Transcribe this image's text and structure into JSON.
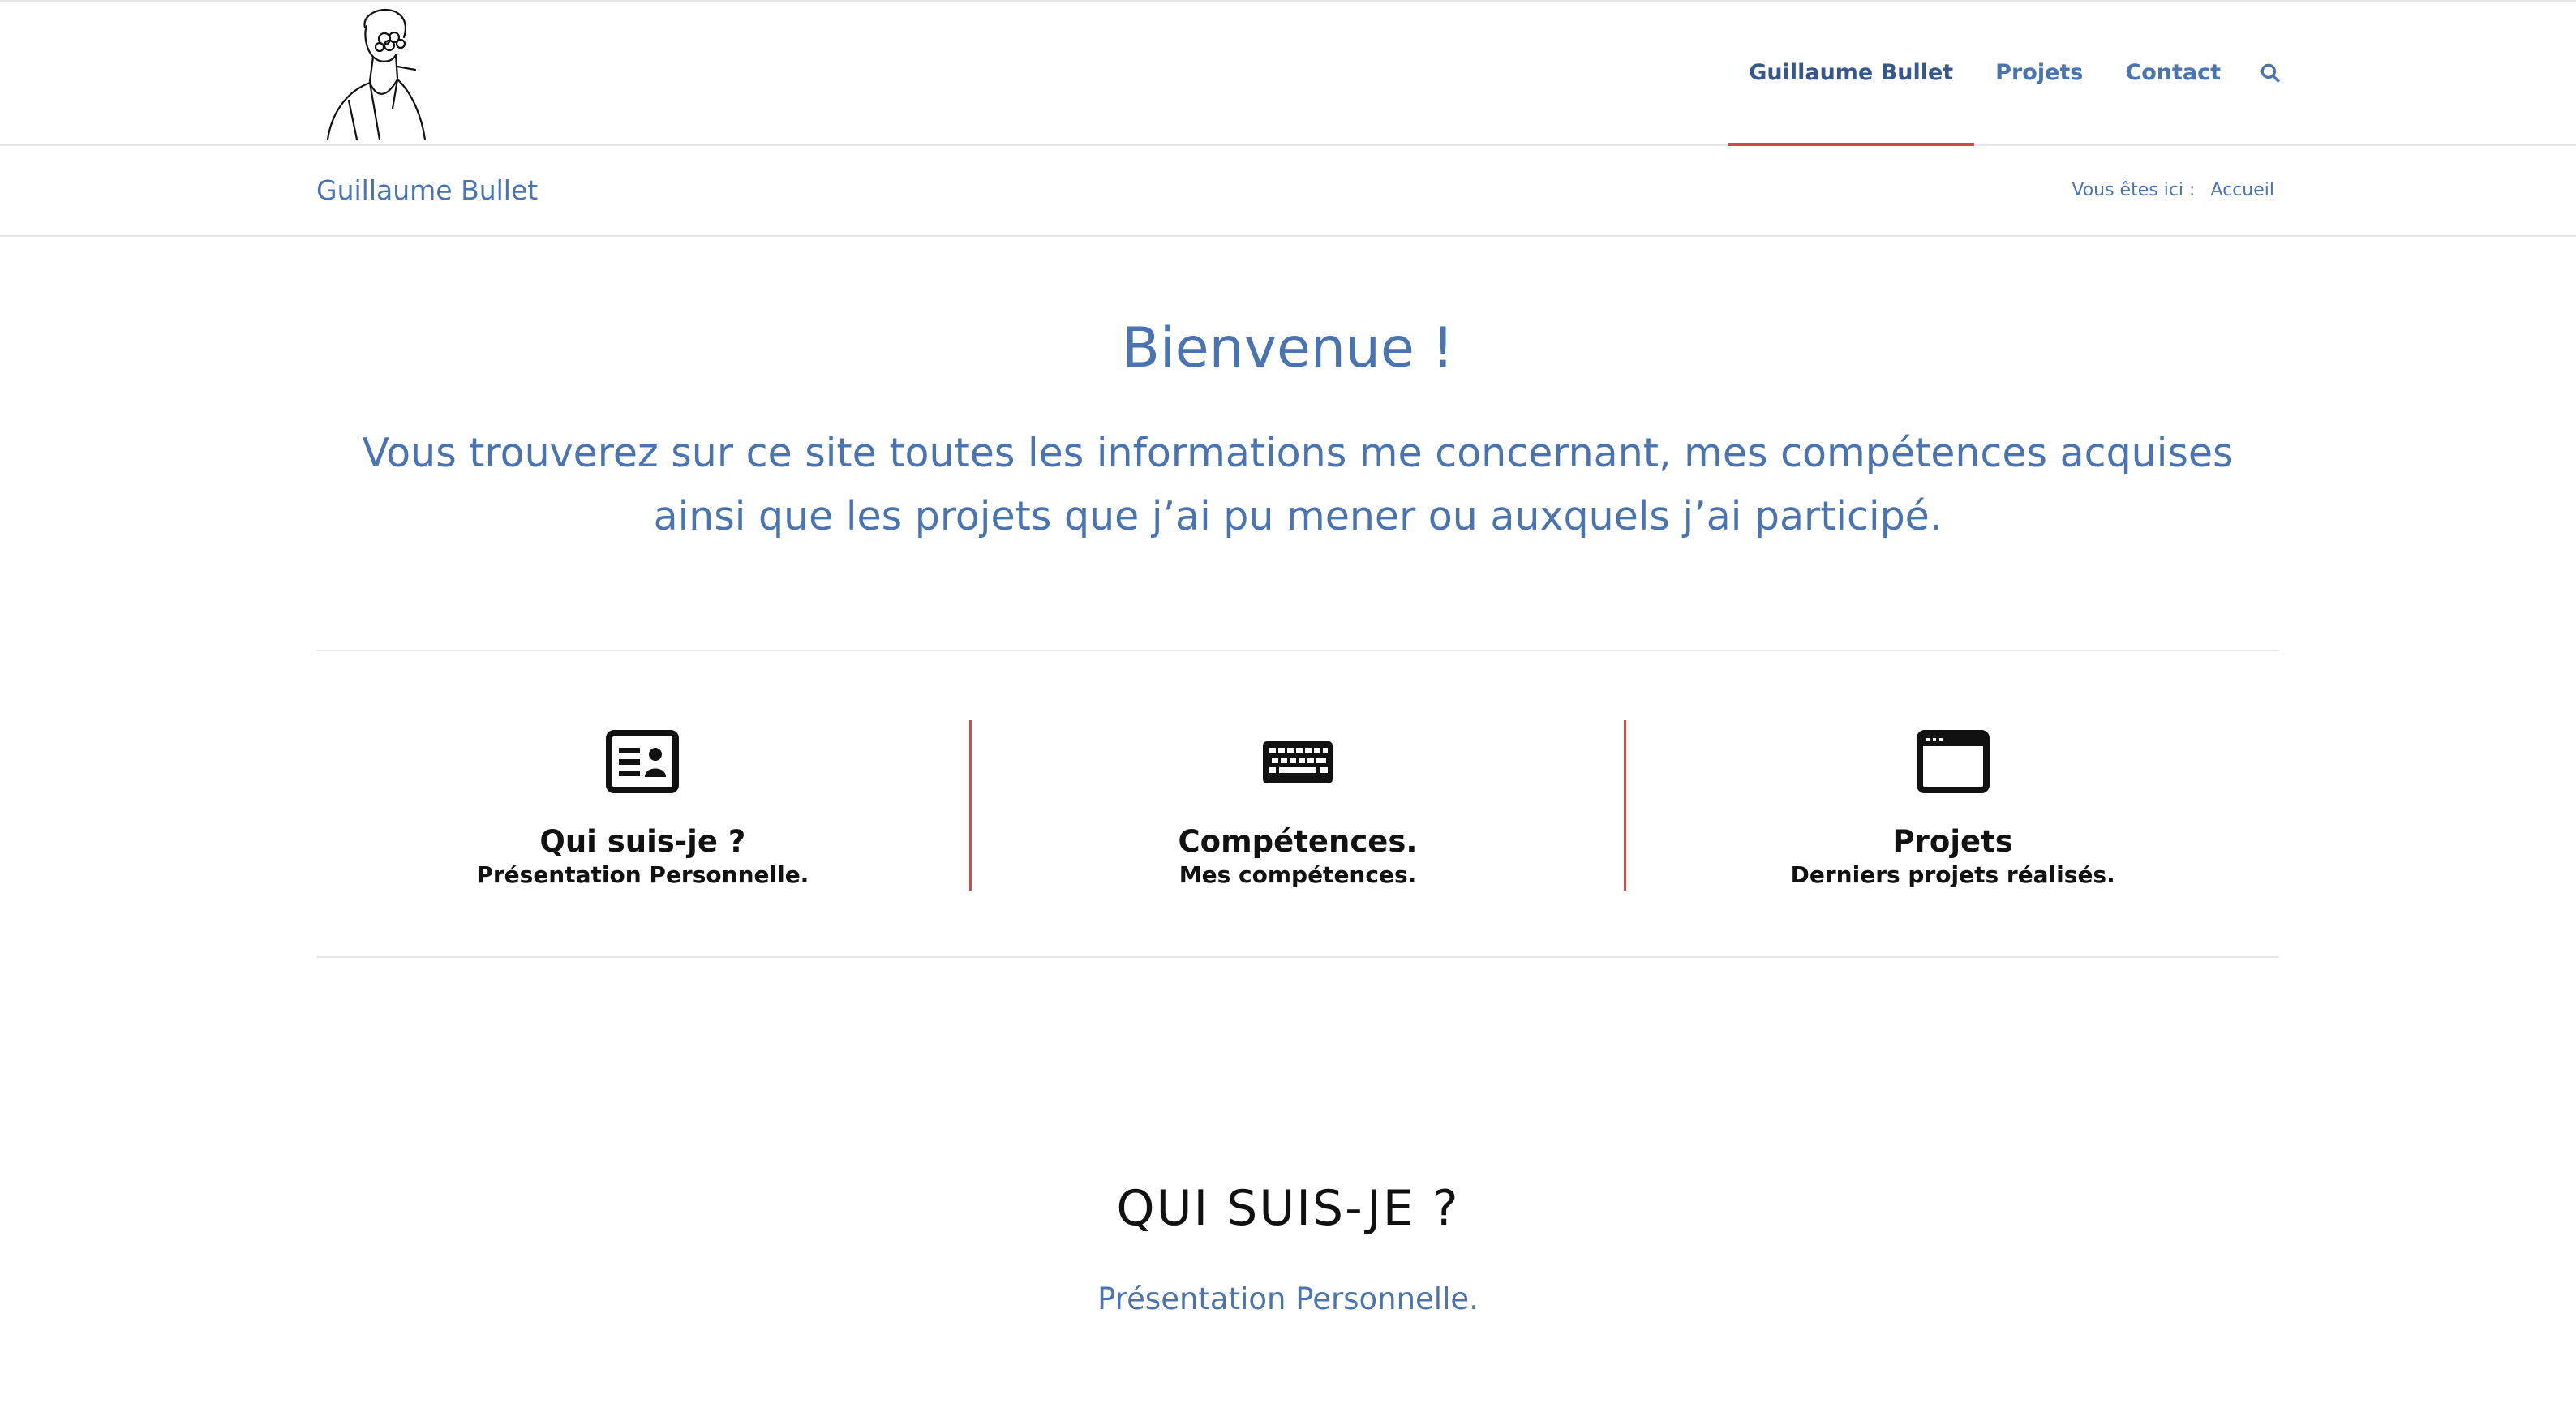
{
  "colors": {
    "accent": "#4a74b1",
    "active_underline": "#d24a4a",
    "divider": "#e6e6e6",
    "text_dark": "#111111"
  },
  "header": {
    "logo": "logo-portrait-illustration",
    "nav": [
      {
        "label": "Guillaume Bullet",
        "active": true
      },
      {
        "label": "Projets",
        "active": false
      },
      {
        "label": "Contact",
        "active": false
      }
    ],
    "search_icon": "search-icon"
  },
  "titlebar": {
    "title": "Guillaume Bullet",
    "breadcrumb_prefix": "Vous êtes ici :",
    "breadcrumb_current": "Accueil"
  },
  "welcome": {
    "title": "Bienvenue !",
    "text": "Vous trouverez sur ce site toutes les informations me concernant,  mes compétences acquises ainsi que les projets que j’ai pu mener ou auxquels j’ai participé."
  },
  "features": [
    {
      "icon": "id-card-icon",
      "title": "Qui suis-je ?",
      "subtitle": "Présentation Personnelle."
    },
    {
      "icon": "keyboard-icon",
      "title": "Compétences.",
      "subtitle": "Mes compétences."
    },
    {
      "icon": "browser-window-icon",
      "title": "Projets",
      "subtitle": "Derniers projets réalisés."
    }
  ],
  "section": {
    "title": "QUI SUIS-JE ?",
    "subtitle": "Présentation Personnelle."
  }
}
